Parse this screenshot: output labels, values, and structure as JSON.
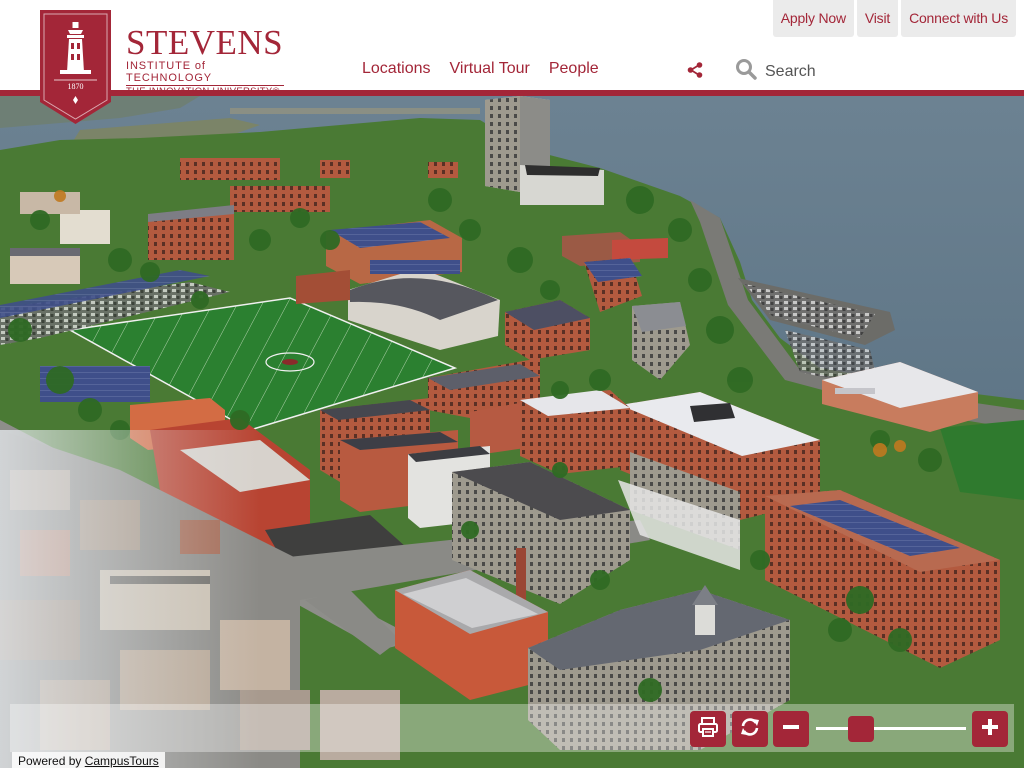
{
  "header": {
    "top_links": [
      {
        "label": "Apply Now"
      },
      {
        "label": "Visit"
      },
      {
        "label": "Connect with Us"
      }
    ],
    "logo": {
      "name": "STEVENS",
      "tagline": "INSTITUTE of TECHNOLOGY",
      "subtitle": "THE INNOVATION UNIVERSITY®",
      "year": "1870"
    },
    "nav": [
      {
        "label": "Locations"
      },
      {
        "label": "Virtual Tour"
      },
      {
        "label": "People"
      }
    ],
    "search": {
      "placeholder": "Search"
    }
  },
  "controls": {
    "zoom_level": 0.3,
    "icons": [
      "print-icon",
      "refresh-icon",
      "zoom-out-icon",
      "zoom-in-icon",
      "share-icon",
      "search-icon"
    ]
  },
  "footer": {
    "powered_prefix": "Powered by",
    "powered_link": "CampusTours"
  },
  "colors": {
    "brand": "#a32638",
    "water": "#5f7585",
    "grass": "#3d7a2c",
    "brick": "#a85038"
  }
}
